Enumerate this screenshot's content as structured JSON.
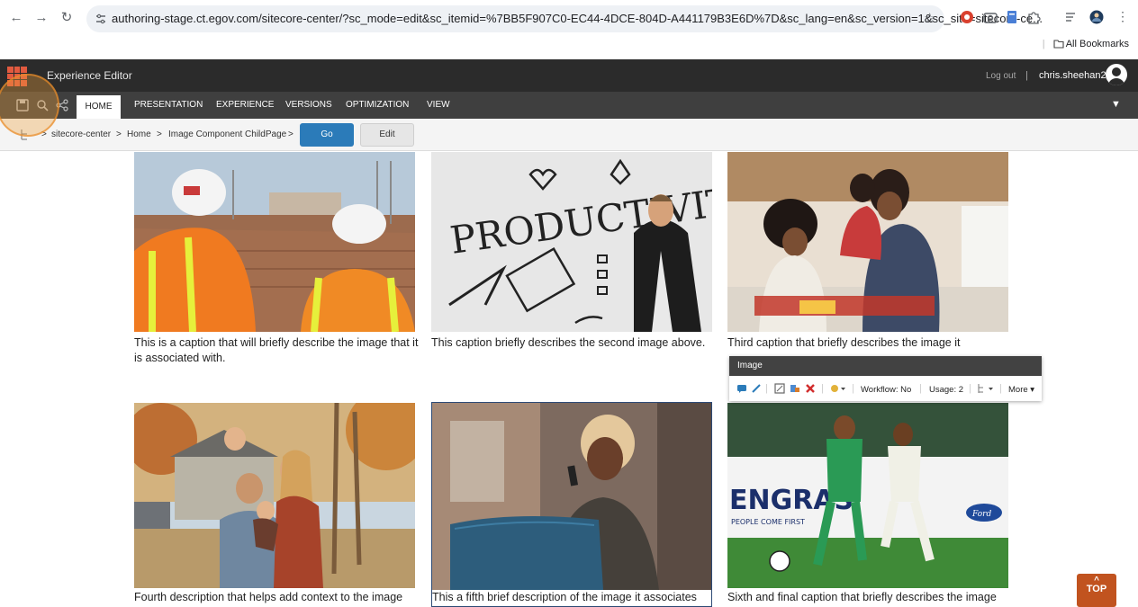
{
  "browser": {
    "url": "authoring-stage.ct.egov.com/sitecore-center/?sc_mode=edit&sc_itemid=%7BB5F907C0-EC44-4DCE-804D-A441179B3E6D%7D&sc_lang=en&sc_version=1&sc_site=sitecore-ce...",
    "bookmarks_label": "All Bookmarks"
  },
  "header": {
    "app_title": "Experience Editor",
    "logout_label": "Log out",
    "separator": "|",
    "username": "chris.sheehan2"
  },
  "ribbon": {
    "tabs": [
      {
        "label": "HOME"
      },
      {
        "label": "PRESENTATION"
      },
      {
        "label": "EXPERIENCE"
      },
      {
        "label": "VERSIONS"
      },
      {
        "label": "OPTIMIZATION"
      },
      {
        "label": "VIEW"
      }
    ]
  },
  "breadcrumb": {
    "items": [
      "sitecore-center",
      "Home",
      "Image Component ChildPage"
    ],
    "separator": ">",
    "go_label": "Go",
    "edit_label": "Edit"
  },
  "images": [
    {
      "caption": "This is a caption that will briefly describe the image that it is associated with."
    },
    {
      "caption": "This caption briefly describes the second image above."
    },
    {
      "caption": "Third caption that briefly describes the image it"
    },
    {
      "caption": "Fourth description that helps add context to the image"
    },
    {
      "caption": "This a fifth brief description of the image it associates"
    },
    {
      "caption": "Sixth and final caption that briefly describes the image"
    }
  ],
  "image_toolbar": {
    "title": "Image",
    "workflow": "Workflow: No",
    "usage": "Usage: 2",
    "more": "More"
  },
  "top_button": {
    "label": "TOP"
  },
  "colors": {
    "accent_orange": "#c1531f",
    "go_blue": "#2b7bb9",
    "header_dark": "#2b2b2b"
  }
}
